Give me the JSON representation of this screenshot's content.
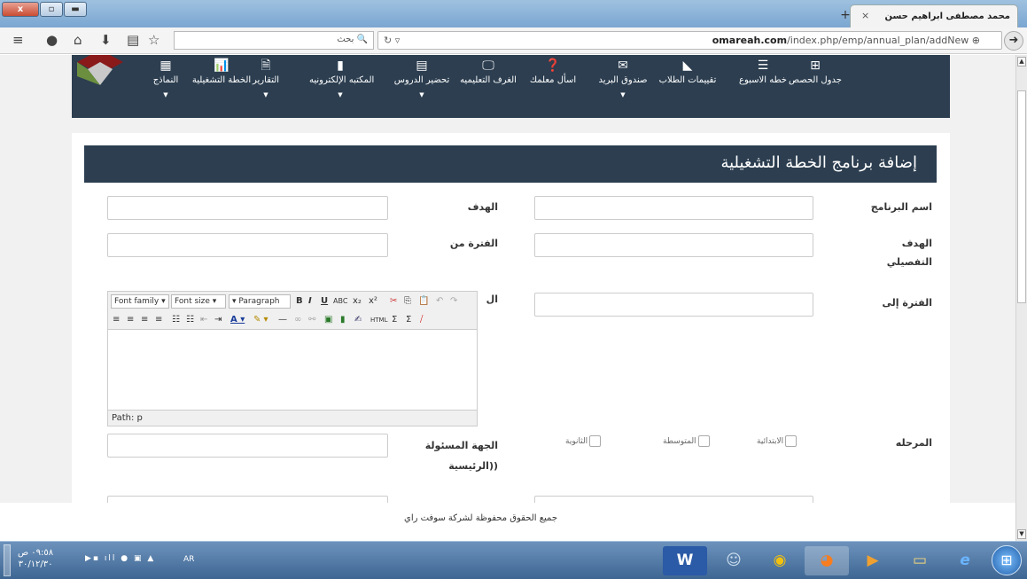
{
  "browser": {
    "tab_title": "محمد مصطفى ابراهيم حسن",
    "tab_close": "×",
    "new_tab": "+",
    "window_buttons": {
      "close": "x",
      "restore": "▫",
      "minimize": "▬"
    },
    "url_domain": "omareah.com",
    "url_path": "/index.php/emp/annual_plan/addNew",
    "search_placeholder": "بحث",
    "toolbar_icons": [
      "menu-icon",
      "chat-icon",
      "home-icon",
      "download-icon",
      "library-icon",
      "bookmark-star-icon"
    ]
  },
  "nav": {
    "items": [
      {
        "label": "جدول الحصص",
        "icon": "⊞",
        "caret": false
      },
      {
        "label": "خطه الاسبوع",
        "icon": "☰",
        "caret": false
      },
      {
        "label": "تقييمات الطلاب",
        "icon": "◣",
        "caret": false
      },
      {
        "label": "صندوق البريد",
        "icon": "✉",
        "caret": true
      },
      {
        "label": "اسأل معلمك",
        "icon": "❓",
        "caret": false
      },
      {
        "label": "الغرف التعليميه",
        "icon": "🖵",
        "caret": false
      },
      {
        "label": "تحضير الدروس",
        "icon": "▤",
        "caret": true
      },
      {
        "label": "المكتبه الإلكترونيه",
        "icon": "▮",
        "caret": true
      },
      {
        "label": "التقارير",
        "icon": "🗎",
        "caret": true
      },
      {
        "label": "الخطة التشغيلية",
        "icon": "📊",
        "caret": false
      },
      {
        "label": "النماذج",
        "icon": "▦",
        "caret": true
      }
    ],
    "caret_symbol": "▼"
  },
  "form": {
    "title": "إضافة برنامج الخطة التشغيلية",
    "labels": {
      "program_name": "اسم البرنامج",
      "goal": "الهدف",
      "detailed_goal_line1": "الهدف",
      "detailed_goal_line2": "التفصيلي",
      "period_from": "الفترة من",
      "period_to": "الفترة إلى",
      "editor_side": "ال",
      "stage": "المرحله",
      "responsible_line1": "الجهة المسئولة",
      "responsible_line2": "((الرئيسية"
    },
    "stages": [
      "الابتدائية",
      "المتوسطة",
      "الثانوية"
    ],
    "editor": {
      "font_family": "Font family",
      "font_size": "Font size",
      "paragraph": "Paragraph",
      "path": "Path: p"
    }
  },
  "footer": {
    "text": "جميع الحقوق محفوظة لشركة سوفت راي"
  },
  "taskbar": {
    "time": "٠٩:٥٨ ص",
    "date": "٣٠/١٢/٣٠",
    "lang": "AR"
  }
}
